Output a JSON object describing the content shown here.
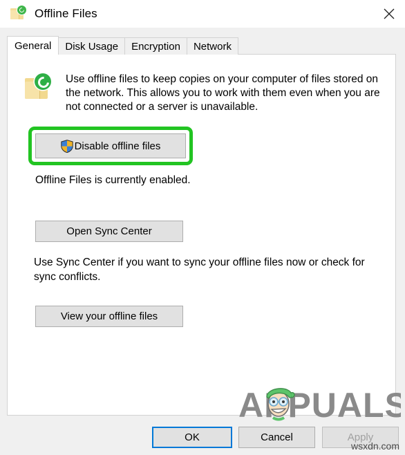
{
  "window": {
    "title": "Offline Files",
    "icon": "offline-files-folder-sync-icon",
    "close_label": "✕"
  },
  "tabs": [
    {
      "label": "General",
      "selected": true
    },
    {
      "label": "Disk Usage",
      "selected": false
    },
    {
      "label": "Encryption",
      "selected": false
    },
    {
      "label": "Network",
      "selected": false
    }
  ],
  "general": {
    "info_icon": "offline-files-folder-sync-icon",
    "description": "Use offline files to keep copies on your computer of files stored on the network.  This allows you to work with them even when you are not connected or a server is unavailable.",
    "disable_button": {
      "label": "Disable offline files",
      "icon": "uac-shield-icon",
      "highlighted": true,
      "highlight_color": "#22c422"
    },
    "status_text": "Offline Files is currently enabled.",
    "sync_center_button": "Open Sync Center",
    "sync_center_description": "Use Sync Center if you want to sync your offline files now or check for sync conflicts.",
    "view_offline_files_button": "View your offline files"
  },
  "footer": {
    "ok": "OK",
    "cancel": "Cancel",
    "apply": "Apply",
    "apply_disabled": true,
    "ok_is_default": true
  },
  "watermarks": {
    "brand": "APPUALS",
    "site": "wsxdn.com"
  },
  "colors": {
    "accent": "#0078d7",
    "highlight_green": "#22c422",
    "dialog_bg": "#f0f0f0",
    "panel_bg": "#ffffff",
    "button_face": "#e1e1e1",
    "button_border": "#adadad",
    "folder_yellow": "#f2d98f",
    "sync_green": "#2faf46"
  }
}
